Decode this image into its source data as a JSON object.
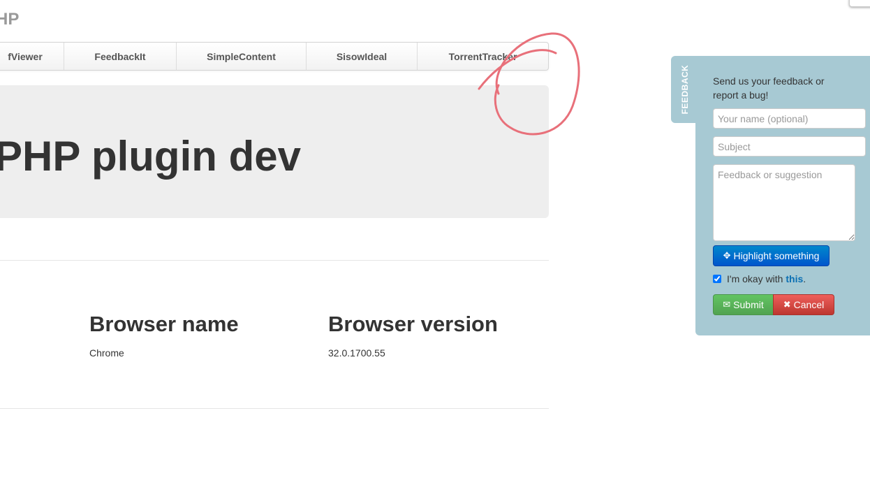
{
  "header": {
    "brand": "HP"
  },
  "nav": {
    "items": [
      {
        "label": "fViewer"
      },
      {
        "label": "FeedbackIt"
      },
      {
        "label": "SimpleContent"
      },
      {
        "label": "SisowIdeal"
      },
      {
        "label": "TorrentTracker"
      }
    ]
  },
  "hero": {
    "title": "PHP plugin dev"
  },
  "browser_info": {
    "name_heading": "Browser name",
    "name_value": "Chrome",
    "version_heading": "Browser version",
    "version_value": "32.0.1700.55"
  },
  "feedback": {
    "tab_label": "FEEDBACK",
    "intro": "Send us your feedback or report a bug!",
    "name_placeholder": "Your name (optional)",
    "subject_placeholder": "Subject",
    "message_placeholder": "Feedback or suggestion",
    "highlight_label": "Highlight something",
    "consent_text": "I'm okay with ",
    "consent_link": "this",
    "consent_suffix": ".",
    "consent_checked": true,
    "submit_label": "Submit",
    "cancel_label": "Cancel",
    "panel_color": "#a7c9d3",
    "highlight_color": "#0066cc",
    "submit_color": "#5bb75b",
    "cancel_color": "#da4f49",
    "annotation_color": "#e8707a"
  },
  "icons": {
    "highlight": "crosshair-icon",
    "submit": "envelope-icon",
    "cancel": "x-icon"
  }
}
